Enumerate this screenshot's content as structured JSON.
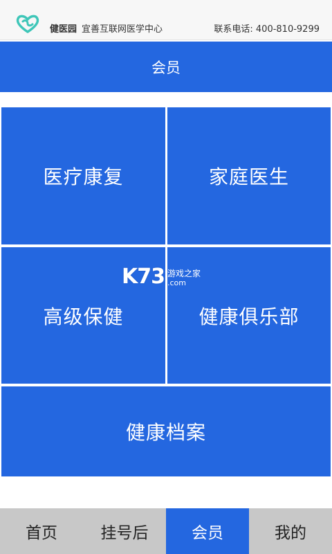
{
  "header": {
    "brand_name": "健医园",
    "slogan": "宜善互联网医学中心",
    "phone": "联系电话: 400-810-9299",
    "logo_icon": "heart-swirl-logo"
  },
  "title_bar": {
    "title": "会员"
  },
  "tiles": [
    {
      "label": "医疗康复"
    },
    {
      "label": "家庭医生"
    },
    {
      "label": "高级保健"
    },
    {
      "label": "健康俱乐部"
    },
    {
      "label": "健康档案"
    }
  ],
  "watermark": {
    "logo_text": "K73",
    "cn_text": "游戏之家",
    "domain_text": ".com"
  },
  "bottom_nav": {
    "items": [
      {
        "label": "首页"
      },
      {
        "label": "挂号后"
      },
      {
        "label": "会员"
      },
      {
        "label": "我的"
      }
    ],
    "active_index": 2
  },
  "colors": {
    "primary": "#2467e0",
    "logo_teal": "#3ec6b8",
    "nav_bg": "#c8c8c8"
  }
}
